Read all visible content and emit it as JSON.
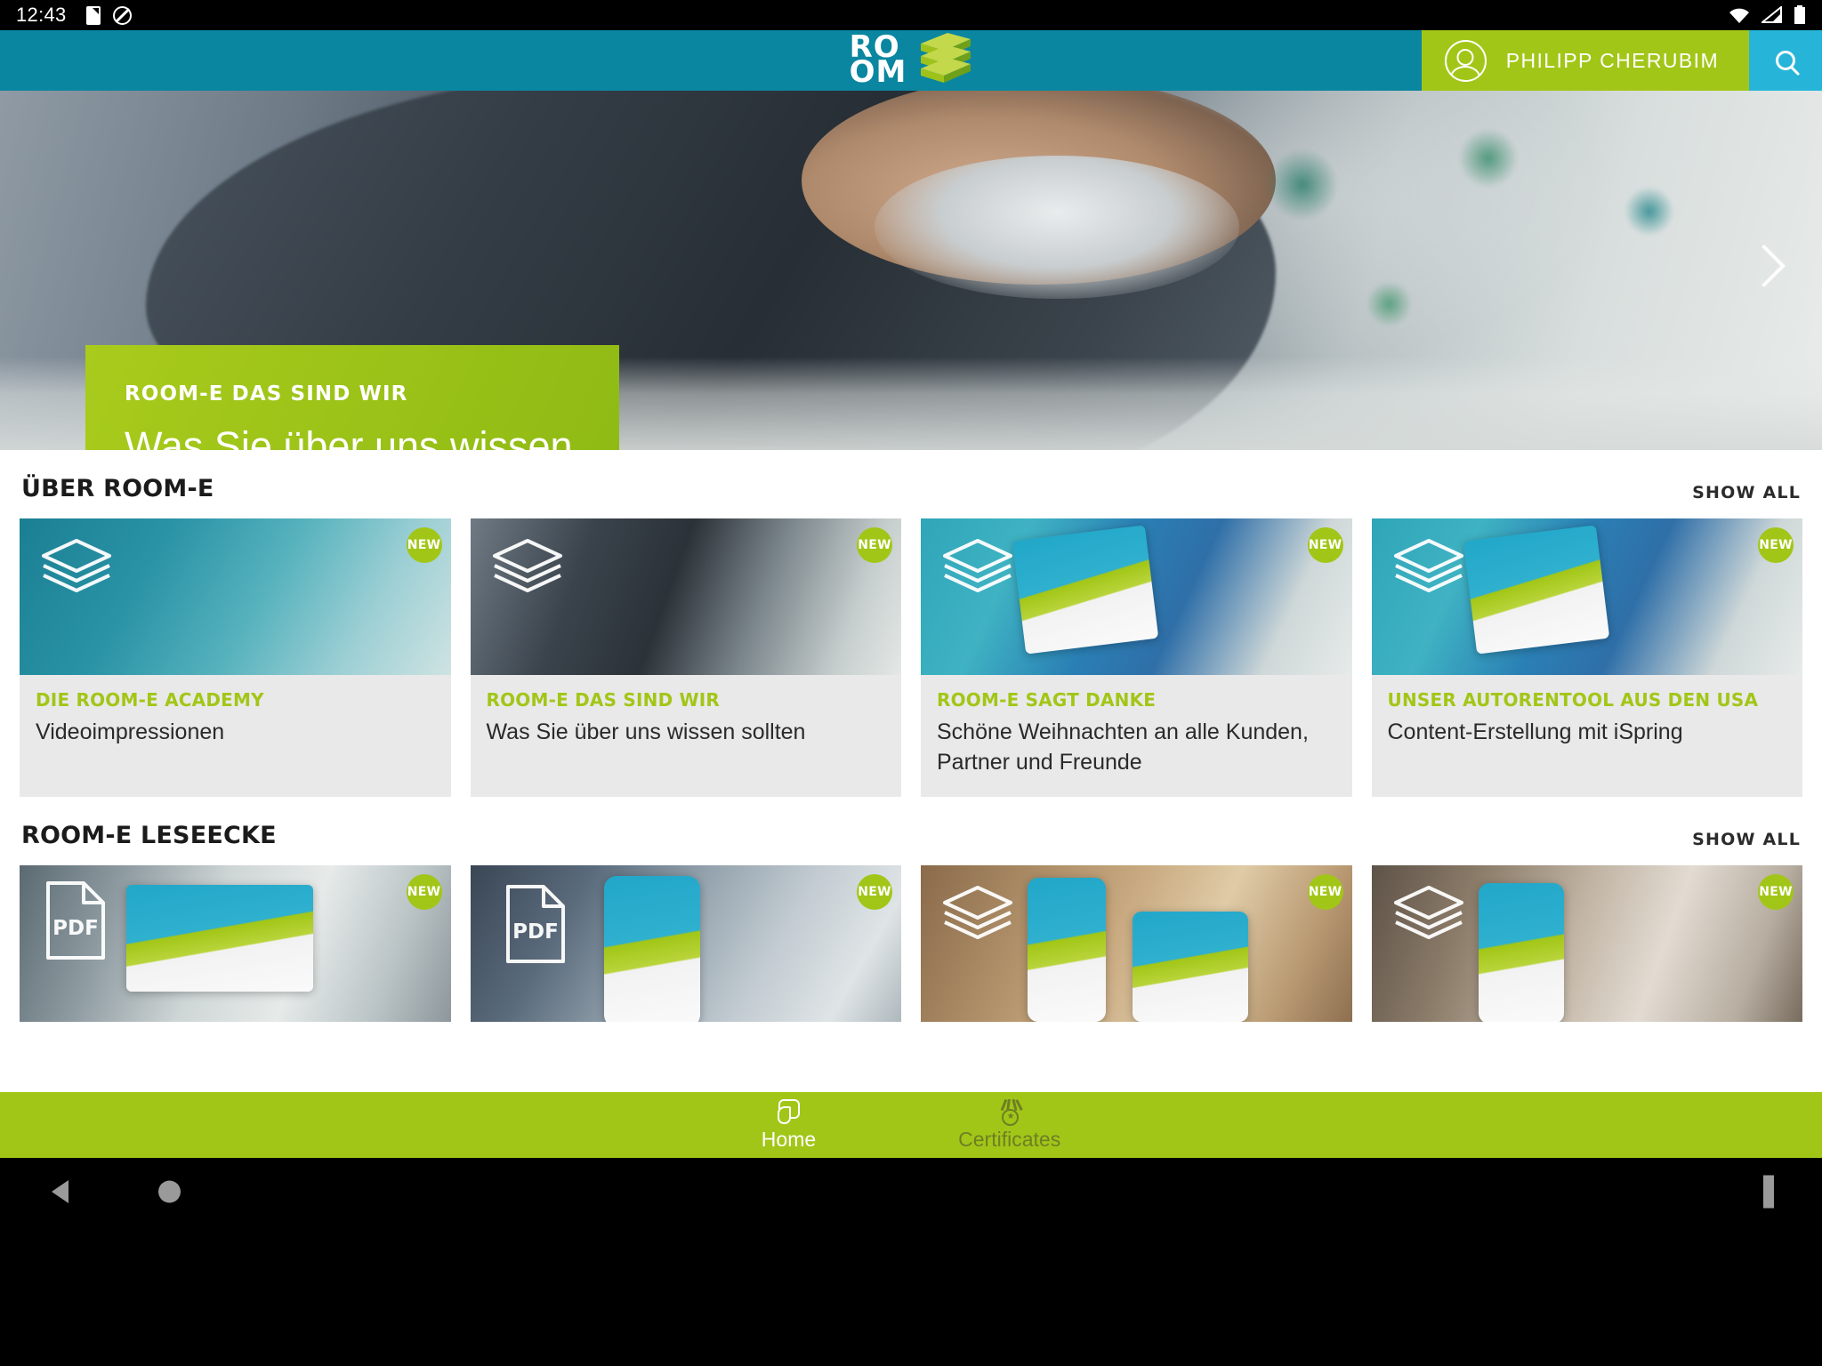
{
  "status_bar": {
    "time": "12:43",
    "left_icons": [
      "sd-card-icon",
      "do-not-disturb-icon"
    ],
    "right_icons": [
      "wifi-icon",
      "cellular-signal-icon",
      "battery-icon"
    ]
  },
  "header": {
    "logo_line1": "RO",
    "logo_line2": "OM",
    "logo_alt": "ROOM-E",
    "user_name": "PHILIPP CHERUBIM",
    "search_icon": "search-icon",
    "avatar_icon": "user-avatar-icon",
    "bg_color": "#0a86a0",
    "user_chip_color": "#a2c617",
    "search_color": "#26b5d8"
  },
  "hero": {
    "eyebrow": "ROOM-E DAS SIND WIR",
    "title": "Was Sie über uns wissen sollten",
    "next_icon": "chevron-right-icon",
    "overlay_color": "#a2c617"
  },
  "sections": [
    {
      "id": "ueber-room-e",
      "title": "ÜBER ROOM-E",
      "show_all": "SHOW ALL",
      "cards": [
        {
          "kicker": "DIE ROOM-E ACADEMY",
          "title": "Videoimpressionen",
          "badge": "NEW",
          "overlay_icon": "layers-icon",
          "thumb": "t-teal"
        },
        {
          "kicker": "ROOM-E DAS SIND WIR",
          "title": "Was Sie über uns wissen sollten",
          "badge": "NEW",
          "overlay_icon": "layers-icon",
          "thumb": "t-office"
        },
        {
          "kicker": "ROOM-E SAGT DANKE",
          "title": "Schöne Weihnachten an alle Kunden, Partner und Freunde",
          "badge": "NEW",
          "overlay_icon": "layers-icon",
          "thumb": "t-blue"
        },
        {
          "kicker": "UNSER AUTORENTOOL AUS DEN USA",
          "title": "Content-Erstellung mit iSpring",
          "badge": "NEW",
          "overlay_icon": "layers-icon",
          "thumb": "t-blue"
        }
      ]
    },
    {
      "id": "room-e-leseecke",
      "title": "ROOM-E LESEECKE",
      "show_all": "SHOW ALL",
      "cards": [
        {
          "kicker": "",
          "title": "",
          "badge": "NEW",
          "overlay_icon": "pdf-file-icon",
          "thumb": "t-laptop"
        },
        {
          "kicker": "",
          "title": "",
          "badge": "NEW",
          "overlay_icon": "pdf-file-icon",
          "thumb": "t-hands"
        },
        {
          "kicker": "",
          "title": "",
          "badge": "NEW",
          "overlay_icon": "layers-icon",
          "thumb": "t-wood"
        },
        {
          "kicker": "",
          "title": "",
          "badge": "NEW",
          "overlay_icon": "layers-icon",
          "thumb": "t-cafe"
        }
      ]
    }
  ],
  "bottom_nav": {
    "bg_color": "#a2c617",
    "items": [
      {
        "label": "Home",
        "icon": "tap-gesture-icon",
        "active": true
      },
      {
        "label": "Certificates",
        "icon": "medal-icon",
        "active": false
      }
    ]
  },
  "system_nav": {
    "back": "back-triangle-icon",
    "home": "home-circle-icon",
    "recents": "recents-square-icon"
  }
}
